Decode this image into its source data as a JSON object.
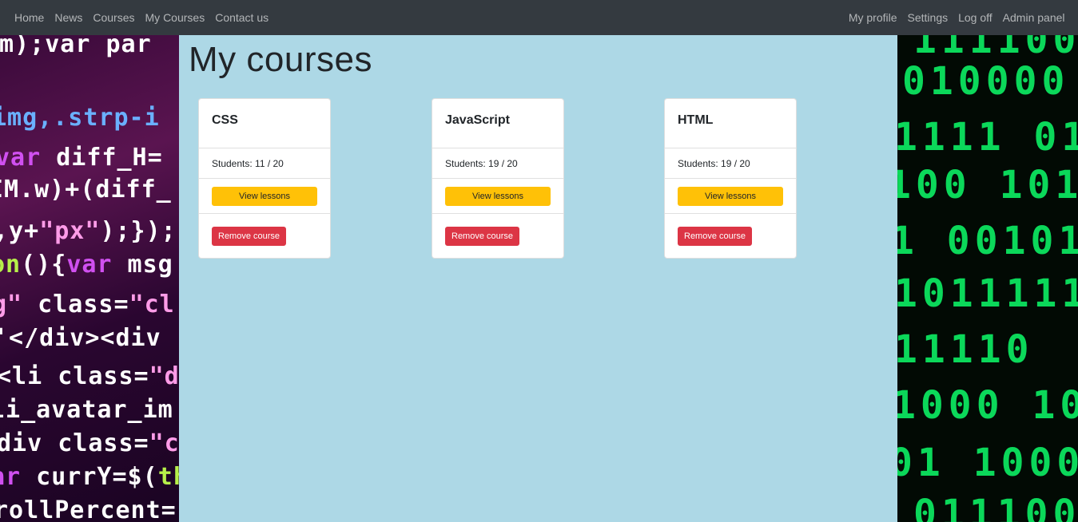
{
  "nav": {
    "left": [
      "Home",
      "News",
      "Courses",
      "My Courses",
      "Contact us"
    ],
    "right": [
      "My profile",
      "Settings",
      "Log off",
      "Admin panel"
    ]
  },
  "page": {
    "title": "My courses"
  },
  "courses": [
    {
      "name": "CSS",
      "students": "Students: 11 / 20",
      "view_label": "View lessons",
      "remove_label": "Remove course"
    },
    {
      "name": "JavaScript",
      "students": "Students: 19 / 20",
      "view_label": "View lessons",
      "remove_label": "Remove course"
    },
    {
      "name": "HTML",
      "students": "Students: 19 / 20",
      "view_label": "View lessons",
      "remove_label": "Remove course"
    }
  ],
  "colors": {
    "navbar": "#343a40",
    "main_bg": "#add8e6",
    "view_button": "#ffc107",
    "remove_button": "#dc3545"
  }
}
